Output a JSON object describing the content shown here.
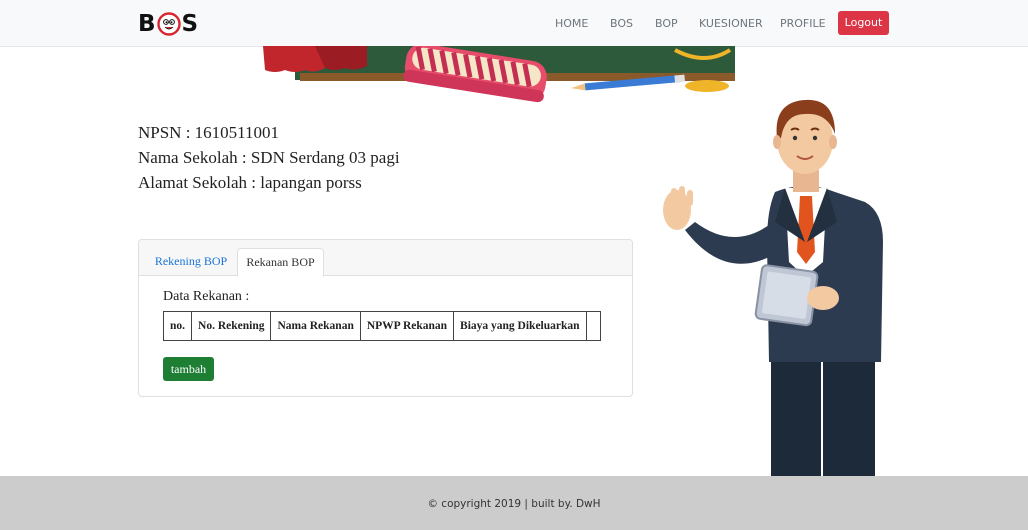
{
  "navbar": {
    "logo_left": "B",
    "logo_right": "S",
    "links": [
      "HOME",
      "BOS",
      "BOP",
      "KUESIONER",
      "PROFILE"
    ],
    "logout_label": "Logout"
  },
  "school": {
    "npsn": "NPSN : 1610511001",
    "nama": "Nama Sekolah : SDN Serdang 03 pagi",
    "alamat": "Alamat Sekolah : lapangan porss"
  },
  "tabs": [
    "Rekening BOP",
    "Rekanan BOP"
  ],
  "active_tab": "Rekanan BOP",
  "rekanan": {
    "title": "Data Rekanan :",
    "columns": [
      "no.",
      "No. Rekening",
      "Nama Rekanan",
      "NPWP Rekanan",
      "Biaya yang Dikeluarkan",
      ""
    ],
    "add_label": "tambah"
  },
  "footer": {
    "text": "© copyright 2019 | built by. DwH"
  },
  "colors": {
    "logout": "#dc3545",
    "tambah": "#1e7e34",
    "tab_link": "#1a73d6",
    "footer_bg": "#cccccc"
  }
}
